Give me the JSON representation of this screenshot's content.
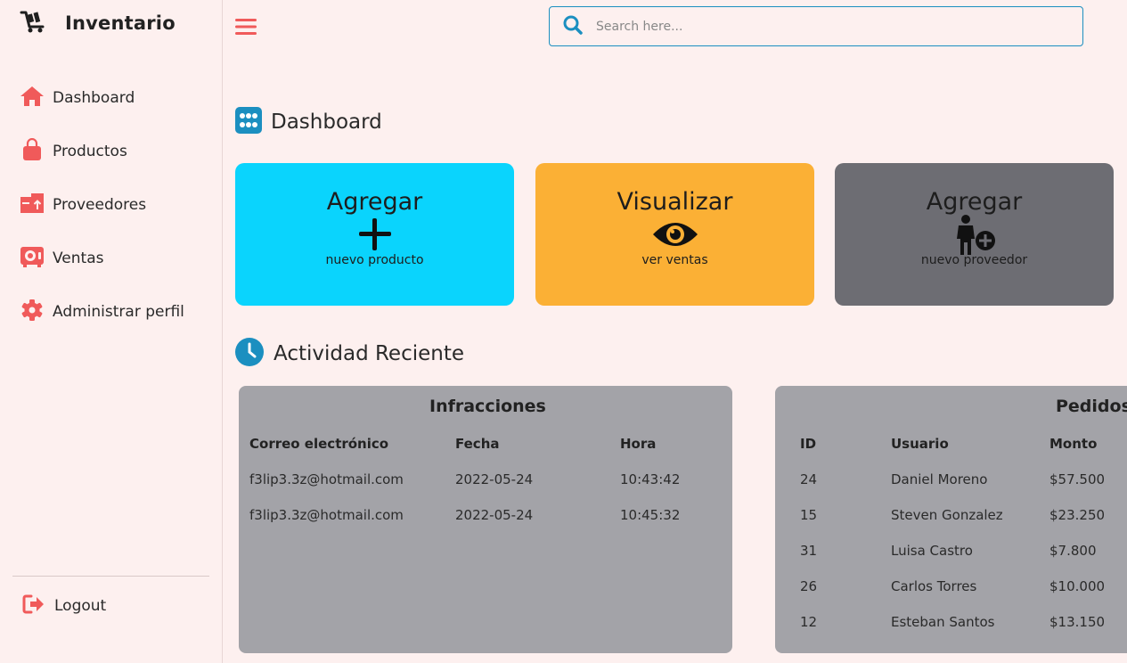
{
  "app": {
    "title": "Inventario"
  },
  "sidebar": {
    "items": [
      {
        "label": "Dashboard"
      },
      {
        "label": "Productos"
      },
      {
        "label": "Proveedores"
      },
      {
        "label": "Ventas"
      },
      {
        "label": "Administrar perfil"
      }
    ],
    "logout_label": "Logout"
  },
  "search": {
    "placeholder": "Search here..."
  },
  "page": {
    "title": "Dashboard"
  },
  "cards": [
    {
      "title": "Agregar",
      "subtitle": "nuevo producto",
      "color": "#0ad4fd",
      "icon": "plus-icon"
    },
    {
      "title": "Visualizar",
      "subtitle": "ver ventas",
      "color": "#fbb035",
      "icon": "eye-icon"
    },
    {
      "title": "Agregar",
      "subtitle": "nuevo proveedor",
      "color": "#6d6d73",
      "icon": "person-add-icon"
    }
  ],
  "activity": {
    "title": "Actividad Reciente"
  },
  "infracciones": {
    "title": "Infracciones",
    "columns": [
      "Correo electrónico",
      "Fecha",
      "Hora"
    ],
    "rows": [
      [
        "f3lip3.3z@hotmail.com",
        "2022-05-24",
        "10:43:42"
      ],
      [
        "f3lip3.3z@hotmail.com",
        "2022-05-24",
        "10:45:32"
      ]
    ]
  },
  "pedidos": {
    "title": "Pedidos",
    "columns": [
      "ID",
      "Usuario",
      "Monto"
    ],
    "rows": [
      [
        "24",
        "Daniel Moreno",
        "$57.500"
      ],
      [
        "15",
        "Steven Gonzalez",
        "$23.250"
      ],
      [
        "31",
        "Luisa Castro",
        "$7.800"
      ],
      [
        "26",
        "Carlos Torres",
        "$10.000"
      ],
      [
        "12",
        "Esteban Santos",
        "$13.150"
      ]
    ]
  },
  "colors": {
    "accent": "#f05a5a",
    "link_blue": "#1b8fc0",
    "panel_gray": "#a3a3a8"
  }
}
